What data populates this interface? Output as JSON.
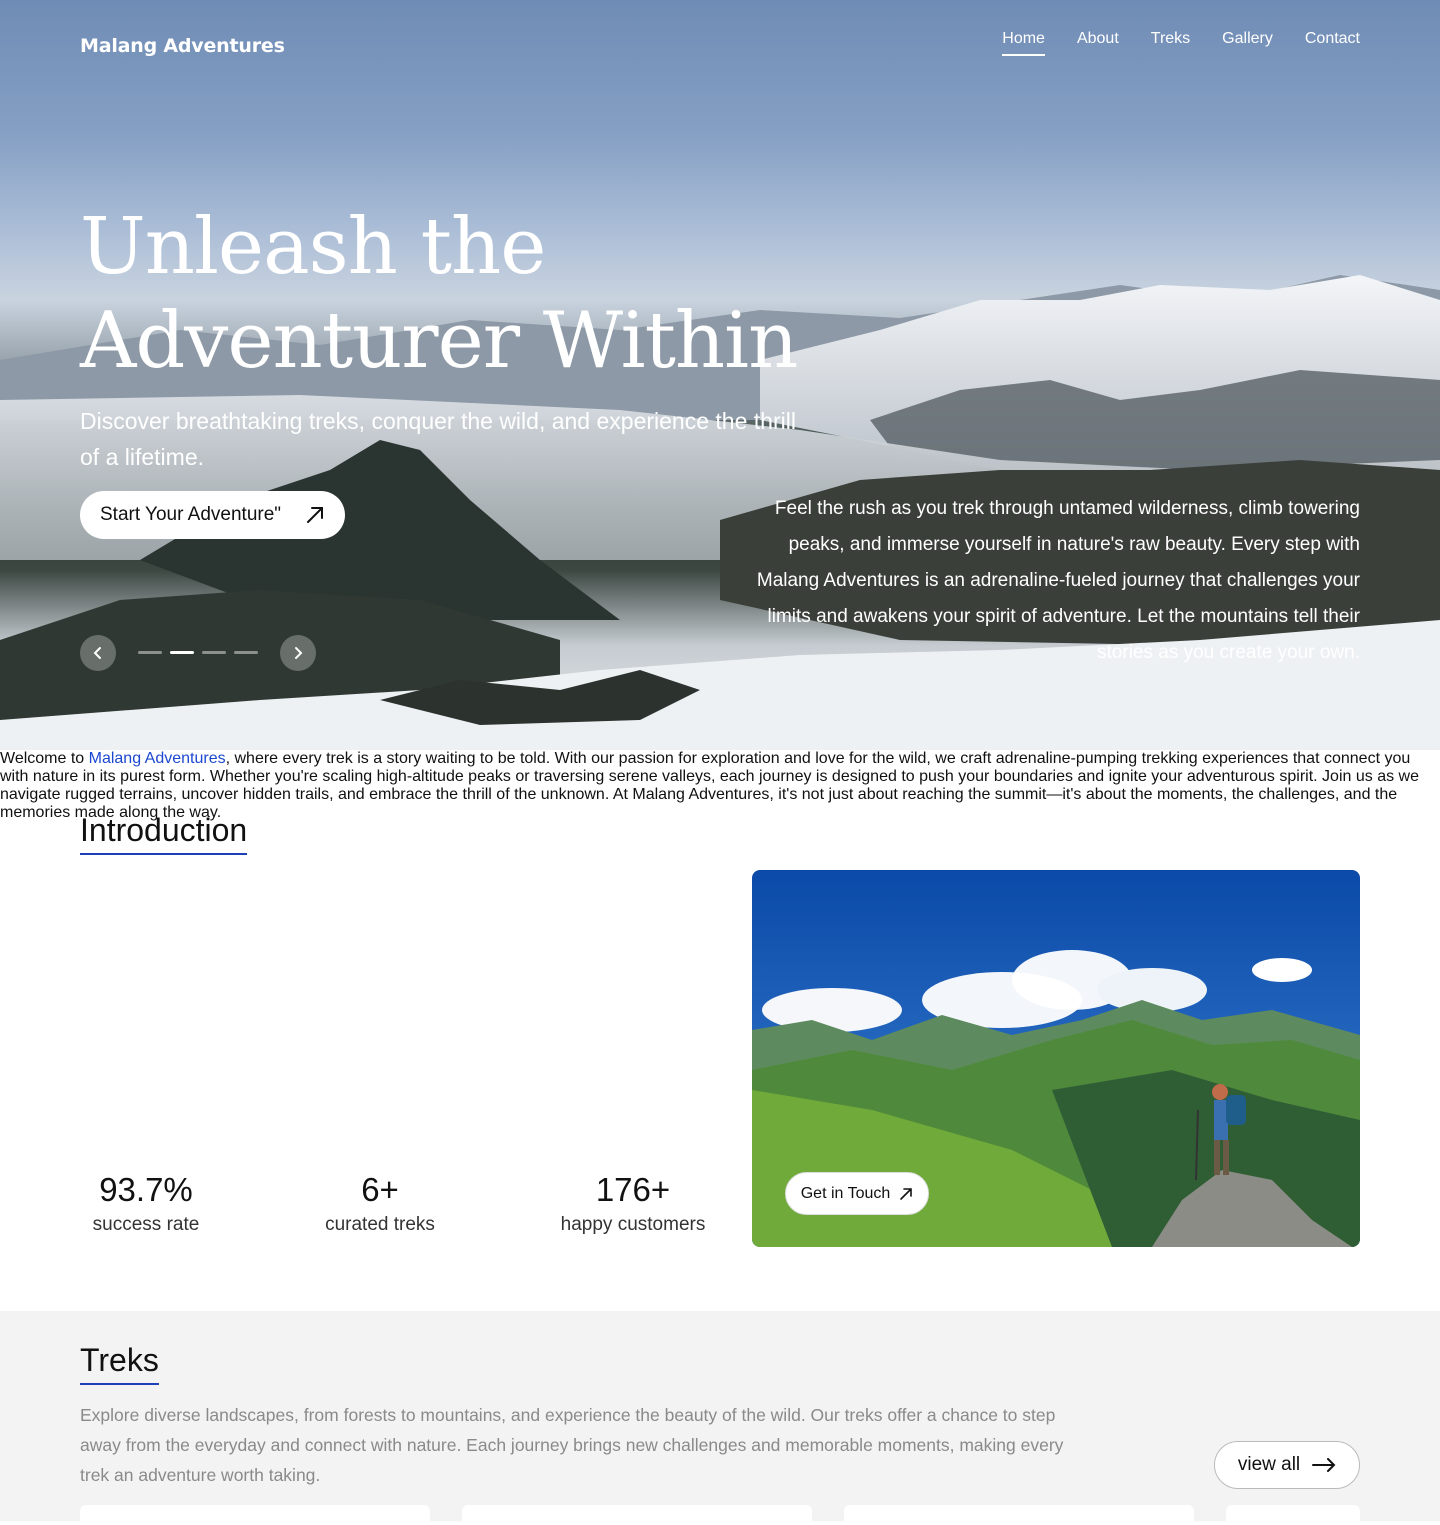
{
  "brand": "Malang Adventures",
  "nav": {
    "items": [
      {
        "label": "Home",
        "active": true
      },
      {
        "label": "About"
      },
      {
        "label": "Treks"
      },
      {
        "label": "Gallery"
      },
      {
        "label": "Contact"
      }
    ]
  },
  "hero": {
    "title_line1": "Unleash the",
    "title_line2": "Adventurer Within",
    "subtitle": "Discover breathtaking treks, conquer the wild, and experience the thrill of a lifetime.",
    "cta_label": "Start Your Adventure\"",
    "description": "Feel the rush as you trek through untamed wilderness, climb towering peaks, and immerse yourself in nature's raw beauty. Every step with Malang Adventures is an adrenaline-fueled journey that challenges your limits and awakens your spirit of adventure. Let the mountains tell their stories as you create your own.",
    "slides_total": 4,
    "active_slide": 2
  },
  "intro": {
    "title": "Introduction",
    "paragraph": [
      {
        "t": "Welcome to "
      },
      {
        "t": "Malang Adventures",
        "s": "b"
      },
      {
        "t": ", where every "
      },
      {
        "t": "trek is a story",
        "s": "k"
      },
      {
        "t": " waiting to be told. With our passion for "
      },
      {
        "t": "exploration",
        "s": "k"
      },
      {
        "t": " and love for the "
      },
      {
        "t": "wild",
        "s": "k"
      },
      {
        "t": ", we craft "
      },
      {
        "t": "adrenaline-pumping",
        "s": "k"
      },
      {
        "t": " trekking experiences that connect you with "
      },
      {
        "t": "nature",
        "s": "k"
      },
      {
        "t": " in its purest form. Whether you're scaling "
      },
      {
        "t": "high-altitude peaks",
        "s": "k"
      },
      {
        "t": " or traversing "
      },
      {
        "t": "serene valleys",
        "s": "k"
      },
      {
        "t": ", each journey is designed to "
      },
      {
        "t": "push",
        "s": "k"
      },
      {
        "t": " your "
      },
      {
        "t": "boundaries",
        "s": "k"
      },
      {
        "t": " and "
      },
      {
        "t": "ignite",
        "s": "k"
      },
      {
        "t": " your adventurous "
      },
      {
        "t": "spirit",
        "s": "k"
      },
      {
        "t": ". Join us as we "
      },
      {
        "t": "navigate",
        "s": "k"
      },
      {
        "t": " rugged terrains, uncover "
      },
      {
        "t": "hidden trails",
        "s": "k"
      },
      {
        "t": ", and embrace the thrill of the unknown. At Malang Adventures, it's not just about reaching the summit—it's about the "
      },
      {
        "t": "moments",
        "s": "k"
      },
      {
        "t": ", the "
      },
      {
        "t": "challenges",
        "s": "k"
      },
      {
        "t": ", and the "
      },
      {
        "t": "memories",
        "s": "k"
      },
      {
        "t": " made along the way."
      }
    ],
    "stats": [
      {
        "value": "93.7%",
        "label": "success rate"
      },
      {
        "value": "6+",
        "label": "curated treks"
      },
      {
        "value": "176+",
        "label": "happy customers"
      }
    ],
    "photo_button": "Get in Touch"
  },
  "treks": {
    "title": "Treks",
    "paragraph": "Explore diverse landscapes, from forests to mountains, and experience the beauty of the wild. Our treks offer a chance to step away from the everyday and connect with nature. Each journey brings new challenges and memorable moments, making every trek an adventure worth taking.",
    "view_all": "view all"
  },
  "colors": {
    "accent": "#1d48d0",
    "underline": "#1d3fb8",
    "muted": "#8a8a8a",
    "section_bg": "#f2f3f2"
  },
  "icons": {
    "cta": "arrow-up-right-icon",
    "prev": "chevron-left-icon",
    "next": "chevron-right-icon",
    "view_all": "arrow-right-icon"
  }
}
